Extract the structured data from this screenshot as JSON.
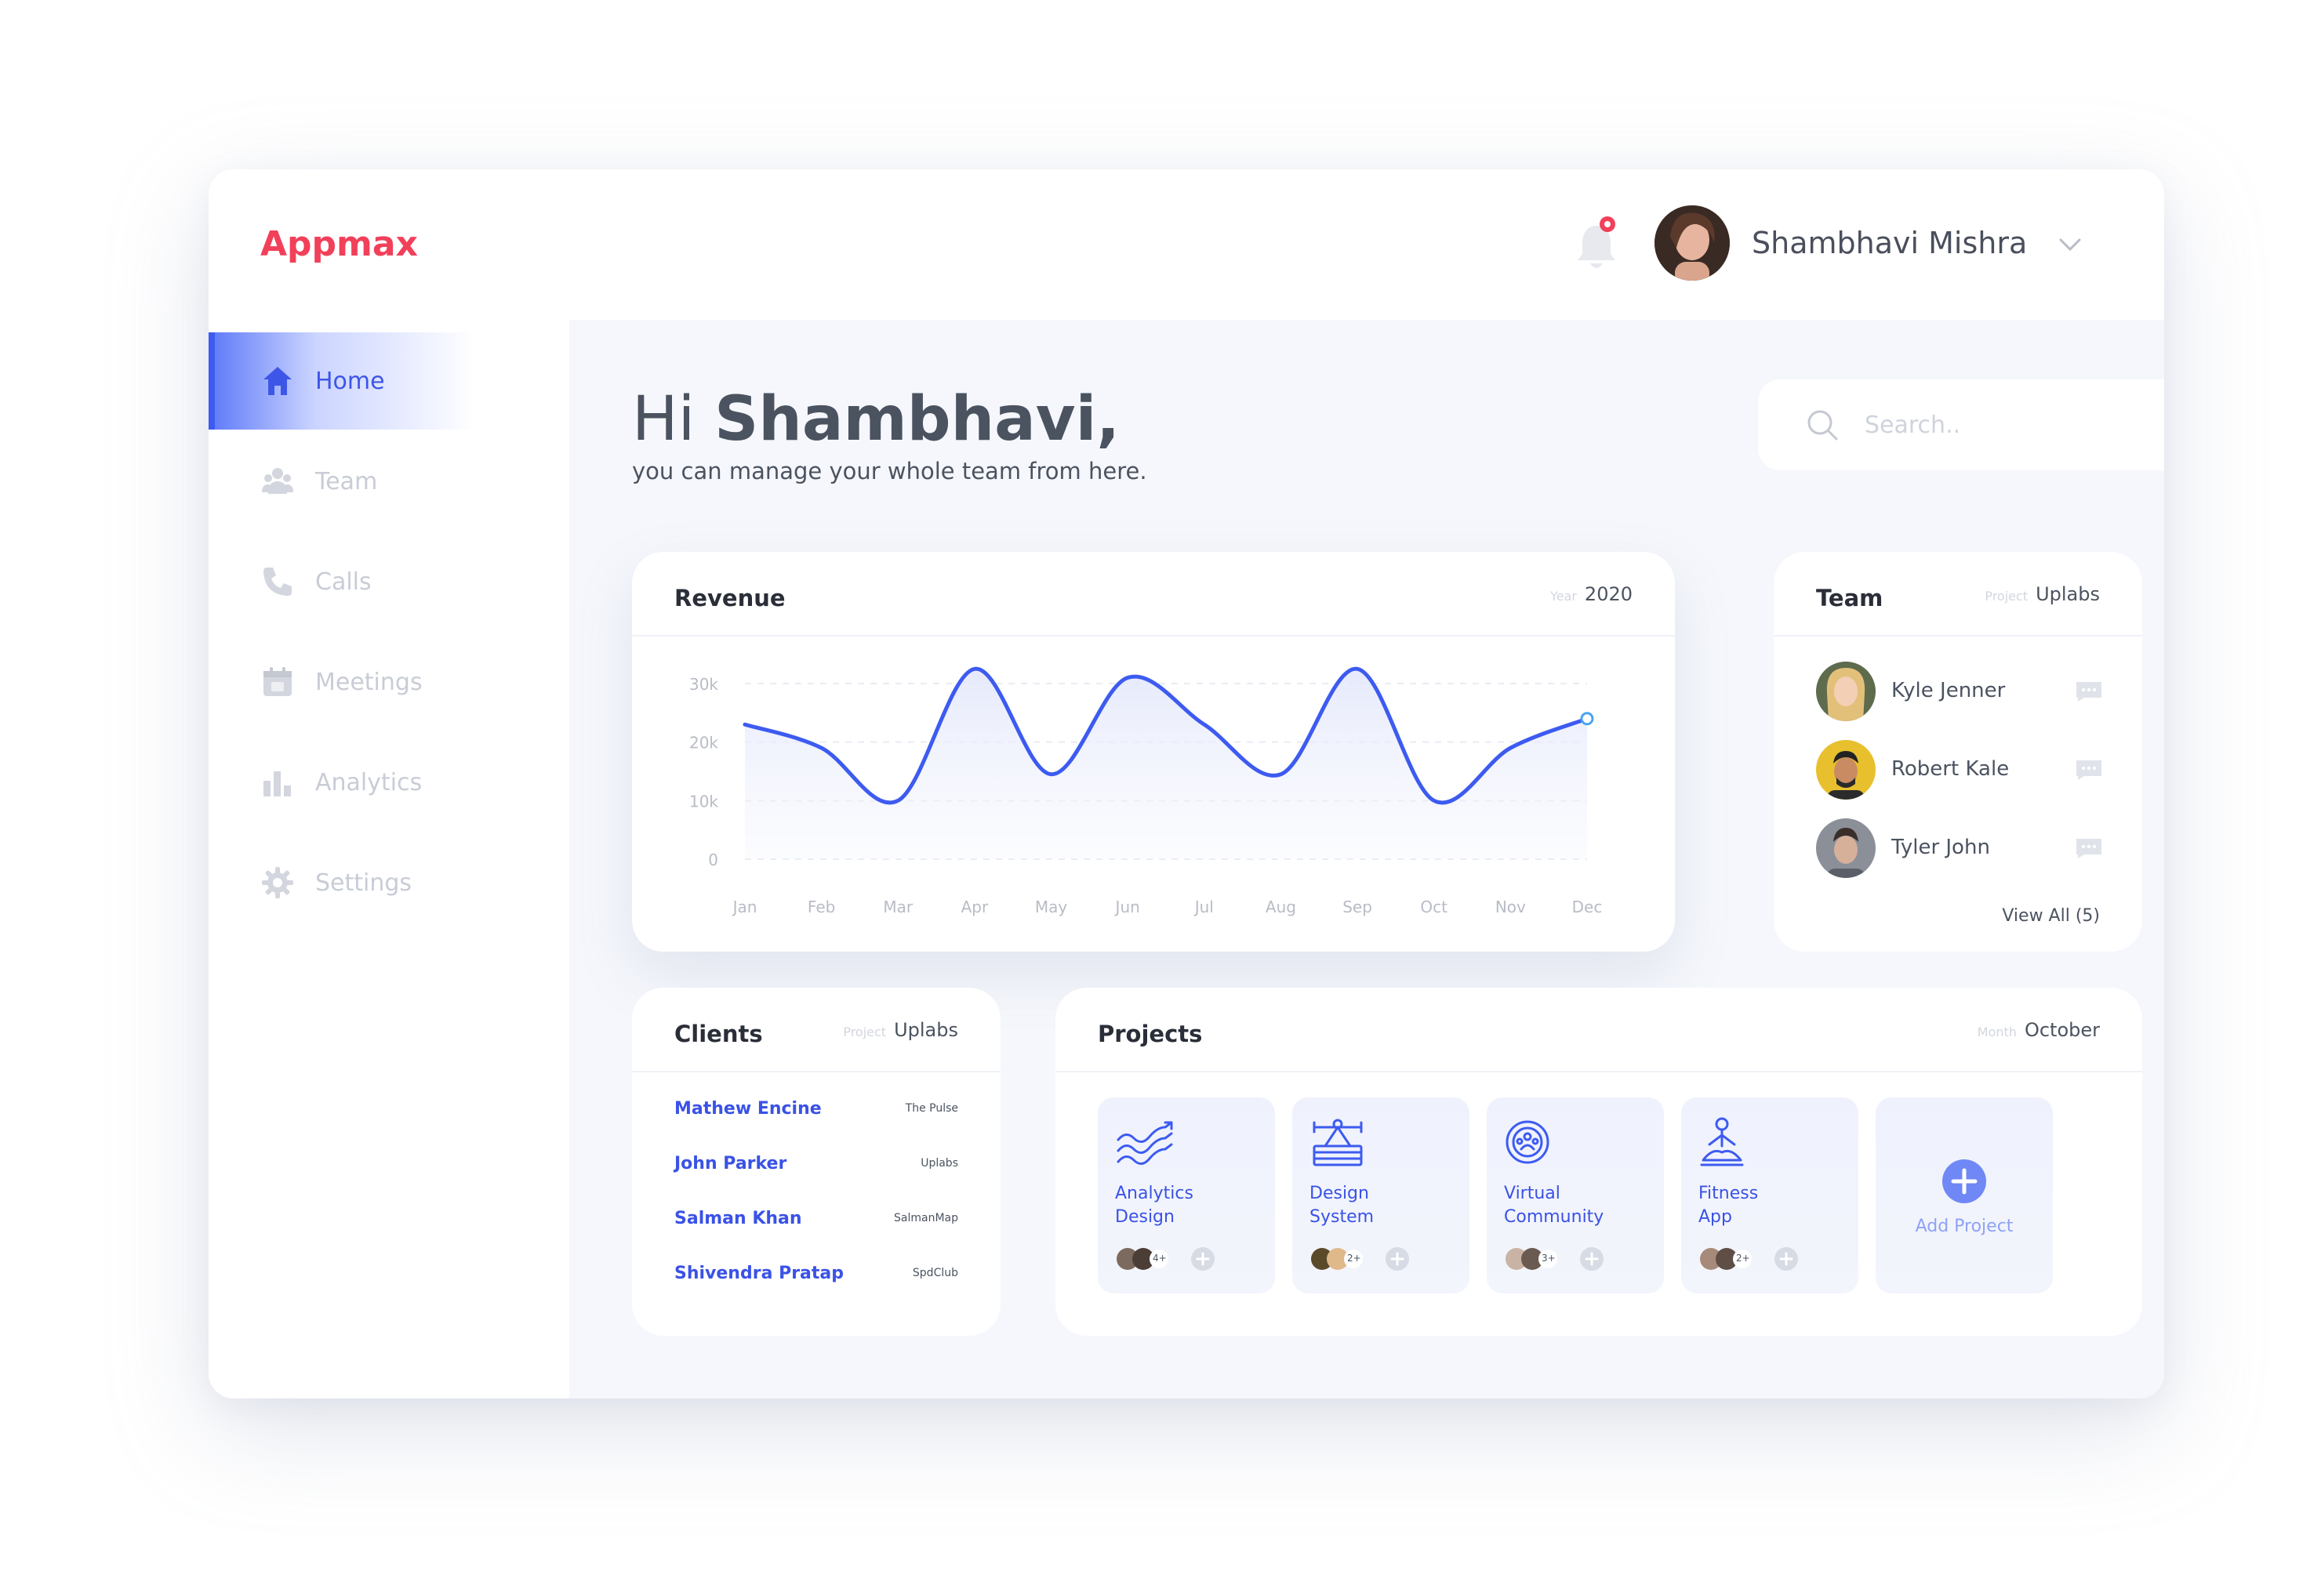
{
  "app": {
    "logo": "Appmax"
  },
  "header": {
    "user_name": "Shambhavi Mishra"
  },
  "sidebar": {
    "items": [
      {
        "label": "Home",
        "icon": "home-icon",
        "active": true
      },
      {
        "label": "Team",
        "icon": "team-icon",
        "active": false
      },
      {
        "label": "Calls",
        "icon": "phone-icon",
        "active": false
      },
      {
        "label": "Meetings",
        "icon": "calendar-icon",
        "active": false
      },
      {
        "label": "Analytics",
        "icon": "bar-chart-icon",
        "active": false
      },
      {
        "label": "Settings",
        "icon": "gear-icon",
        "active": false
      }
    ]
  },
  "greeting": {
    "prefix": "Hi",
    "name": "Shambhavi,",
    "subtitle": "you can manage your whole team from here."
  },
  "search": {
    "placeholder": "Search..",
    "value": ""
  },
  "revenue": {
    "title": "Revenue",
    "meta_key": "Year",
    "meta_value": "2020"
  },
  "chart_data": {
    "type": "line",
    "title": "Revenue",
    "categories": [
      "Jan",
      "Feb",
      "Mar",
      "Apr",
      "May",
      "Jun",
      "Jul",
      "Aug",
      "Sep",
      "Oct",
      "Nov",
      "Dec"
    ],
    "y_ticks": [
      "30k",
      "20k",
      "10k",
      "0"
    ],
    "ylim": [
      0,
      30000
    ],
    "values": [
      23000,
      19000,
      10000,
      32500,
      14500,
      31000,
      23000,
      14500,
      32500,
      10000,
      19000,
      24000
    ],
    "grid": true,
    "colors": {
      "line": "#3d5bf0",
      "fill": "#e8ebfb"
    }
  },
  "team": {
    "title": "Team",
    "meta_key": "Project",
    "meta_value": "Uplabs",
    "members": [
      {
        "name": "Kyle Jenner"
      },
      {
        "name": "Robert Kale"
      },
      {
        "name": "Tyler John"
      }
    ],
    "view_all": "View All (5)"
  },
  "clients": {
    "title": "Clients",
    "meta_key": "Project",
    "meta_value": "Uplabs",
    "rows": [
      {
        "name": "Mathew Encine",
        "company": "The Pulse"
      },
      {
        "name": "John Parker",
        "company": "Uplabs"
      },
      {
        "name": "Salman Khan",
        "company": "SalmanMap"
      },
      {
        "name": "Shivendra Pratap",
        "company": "SpdClub"
      }
    ]
  },
  "projects": {
    "title": "Projects",
    "meta_key": "Month",
    "meta_value": "October",
    "items": [
      {
        "line1": "Analytics",
        "line2": "Design",
        "count": "4+",
        "icon": "analytics-design-icon"
      },
      {
        "line1": "Design",
        "line2": "System",
        "count": "2+",
        "icon": "design-system-icon"
      },
      {
        "line1": "Virtual",
        "line2": "Community",
        "count": "3+",
        "icon": "virtual-community-icon"
      },
      {
        "line1": "Fitness",
        "line2": "App",
        "count": "2+",
        "icon": "fitness-app-icon"
      }
    ],
    "add_label": "Add Project"
  },
  "colors": {
    "accent": "#3d5bf0",
    "brand": "#f2405a",
    "notification": "#f2405a"
  }
}
